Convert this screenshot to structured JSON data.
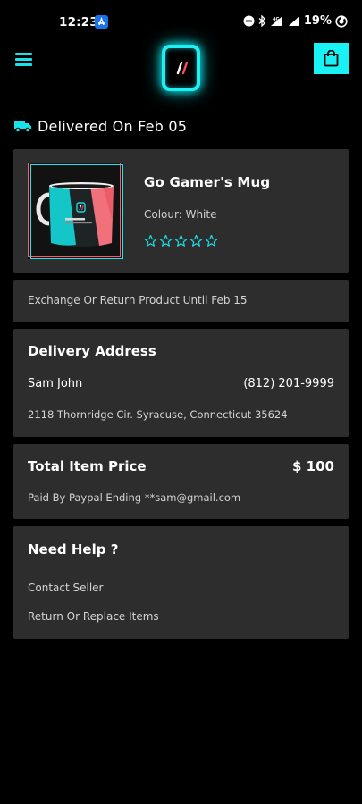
{
  "status_bar": {
    "time": "12:23",
    "battery": "19%",
    "network": "4G",
    "icons": [
      "dnd-icon",
      "bluetooth-icon",
      "signal-icon",
      "signal-icon",
      "battery-icon"
    ]
  },
  "header": {
    "menu_icon": "hamburger-menu-icon",
    "logo_icon": "brand-logo-icon",
    "cart_icon": "shopping-bag-icon"
  },
  "delivery": {
    "icon": "truck-icon",
    "status": "Delivered On Feb 05"
  },
  "product": {
    "name": "Go Gamer's Mug",
    "colour": "Colour: White",
    "rating": 0,
    "rating_max": 5
  },
  "return_policy": {
    "text": "Exchange Or Return Product Until Feb 15"
  },
  "address": {
    "title": "Delivery Address",
    "name": "Sam John",
    "phone": "(812) 201-9999",
    "line": "2118 Thornridge Cir. Syracuse, Connecticut 35624"
  },
  "price": {
    "title": "Total Item Price",
    "value": "$ 100",
    "paid_by": "Paid By Paypal Ending **sam@gmail.com"
  },
  "help": {
    "title": "Need Help ?",
    "links": [
      "Contact Seller",
      "Return Or Replace Items"
    ]
  },
  "colors": {
    "accent": "#19e3ea",
    "card": "#2d2d2d",
    "background": "#000000"
  }
}
